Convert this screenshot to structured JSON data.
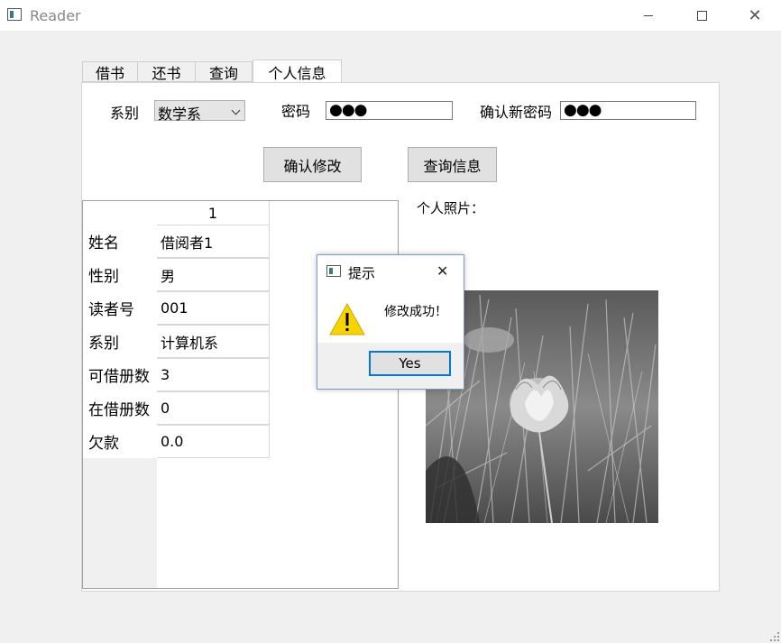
{
  "window": {
    "title": "Reader"
  },
  "tabs": [
    "借书",
    "还书",
    "查询",
    "个人信息"
  ],
  "form": {
    "dept_label": "系别",
    "dept_value": "数学系",
    "password_label": "密码",
    "password_mask": "●●●",
    "confirm_label": "确认新密码",
    "confirm_mask": "●●●",
    "confirm_button": "确认修改",
    "query_button": "查询信息"
  },
  "table": {
    "column_header": "1",
    "rows": [
      {
        "label": "姓名",
        "value": "借阅者1"
      },
      {
        "label": "性别",
        "value": "男"
      },
      {
        "label": "读者号",
        "value": "001"
      },
      {
        "label": "系别",
        "value": "计算机系"
      },
      {
        "label": "可借册数",
        "value": "3"
      },
      {
        "label": "在借册数",
        "value": "0"
      },
      {
        "label": "欠款",
        "value": "0.0"
      }
    ]
  },
  "photo_label": "个人照片：",
  "dialog": {
    "title": "提示",
    "message": "修改成功！",
    "ok_label": "Yes",
    "icon": "warning-icon"
  },
  "colors": {
    "accent": "#0078d7",
    "warning": "#f7d400"
  }
}
